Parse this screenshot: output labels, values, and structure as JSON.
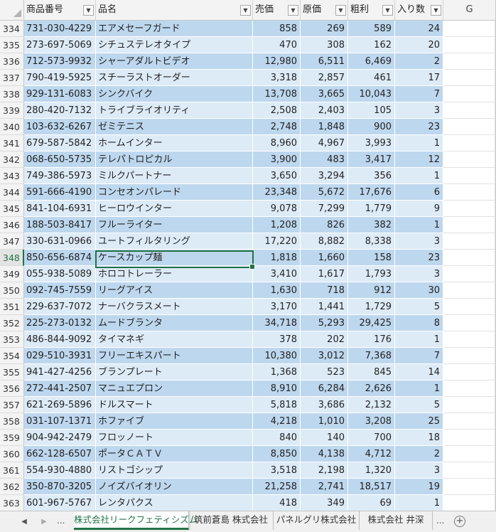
{
  "columns": {
    "a": "商品番号",
    "b": "品名",
    "c": "売価",
    "d": "原価",
    "e": "粗利",
    "f": "入り数",
    "g": "G"
  },
  "filter_icon": "filter-dropdown-icon",
  "selected_row": "348",
  "rows": [
    [
      "334",
      "731-030-4229",
      "エアメセーフガード",
      "858",
      "269",
      "589",
      "24"
    ],
    [
      "335",
      "273-697-5069",
      "シチュステレオタイプ",
      "470",
      "308",
      "162",
      "20"
    ],
    [
      "336",
      "712-573-9932",
      "シャーアダルトビデオ",
      "12,980",
      "6,511",
      "6,469",
      "2"
    ],
    [
      "337",
      "790-419-5925",
      "スチーラストオーダー",
      "3,318",
      "2,857",
      "461",
      "17"
    ],
    [
      "338",
      "929-131-6083",
      "シンクバイク",
      "13,708",
      "3,665",
      "10,043",
      "7"
    ],
    [
      "339",
      "280-420-7132",
      "トライブライオリティ",
      "2,508",
      "2,403",
      "105",
      "3"
    ],
    [
      "340",
      "103-632-6267",
      "ゼミテニス",
      "2,748",
      "1,848",
      "900",
      "23"
    ],
    [
      "341",
      "679-587-5842",
      "ホームインター",
      "8,960",
      "4,967",
      "3,993",
      "1"
    ],
    [
      "342",
      "068-650-5735",
      "テレパトロピカル",
      "3,900",
      "483",
      "3,417",
      "12"
    ],
    [
      "343",
      "749-386-5973",
      "ミルクパートナー",
      "3,650",
      "3,294",
      "356",
      "1"
    ],
    [
      "344",
      "591-666-4190",
      "コンセオンパレード",
      "23,348",
      "5,672",
      "17,676",
      "6"
    ],
    [
      "345",
      "841-104-6931",
      "ヒーロウインター",
      "9,078",
      "7,299",
      "1,779",
      "9"
    ],
    [
      "346",
      "188-503-8417",
      "フルーライター",
      "1,208",
      "826",
      "382",
      "1"
    ],
    [
      "347",
      "330-631-0966",
      "ユートフィルタリング",
      "17,220",
      "8,882",
      "8,338",
      "3"
    ],
    [
      "348",
      "850-656-6874",
      "ケースカップ麺",
      "1,818",
      "1,660",
      "158",
      "23"
    ],
    [
      "349",
      "055-938-5089",
      "ホロコトレーラー",
      "3,410",
      "1,617",
      "1,793",
      "3"
    ],
    [
      "350",
      "092-745-7559",
      "リーグアイス",
      "1,630",
      "718",
      "912",
      "30"
    ],
    [
      "351",
      "229-637-7072",
      "ナーバクラスメート",
      "3,170",
      "1,441",
      "1,729",
      "5"
    ],
    [
      "352",
      "225-273-0132",
      "ムードブランタ",
      "34,718",
      "5,293",
      "29,425",
      "8"
    ],
    [
      "353",
      "486-844-9092",
      "タイマネギ",
      "378",
      "202",
      "176",
      "1"
    ],
    [
      "354",
      "029-510-3931",
      "フリーエキスパート",
      "10,380",
      "3,012",
      "7,368",
      "7"
    ],
    [
      "355",
      "941-427-4256",
      "ブランプレート",
      "1,368",
      "523",
      "845",
      "14"
    ],
    [
      "356",
      "272-441-2507",
      "マニュエプロン",
      "8,910",
      "6,284",
      "2,626",
      "1"
    ],
    [
      "357",
      "621-269-5896",
      "ドルスマート",
      "5,818",
      "3,686",
      "2,132",
      "5"
    ],
    [
      "358",
      "031-107-1371",
      "ホファイブ",
      "4,218",
      "1,010",
      "3,208",
      "25"
    ],
    [
      "359",
      "904-942-2479",
      "フロッノート",
      "840",
      "140",
      "700",
      "18"
    ],
    [
      "360",
      "662-128-6507",
      "ポータＣＡＴＶ",
      "8,850",
      "4,138",
      "4,712",
      "2"
    ],
    [
      "361",
      "554-930-4880",
      "リストゴシップ",
      "3,518",
      "2,198",
      "1,320",
      "3"
    ],
    [
      "362",
      "350-870-3205",
      "ノイズバイオリン",
      "21,258",
      "2,741",
      "18,517",
      "19"
    ],
    [
      "363",
      "601-967-5767",
      "レンタパクス",
      "418",
      "349",
      "69",
      "1"
    ]
  ],
  "tabs": {
    "nav_prev": "◀",
    "nav_next": "▶",
    "ellipsis_left": "...",
    "items": [
      "株式会社リークフェティシズム",
      "筑前蒼島 株式会社",
      "パネルグリ株式会社",
      "株式会社 井深"
    ],
    "ellipsis_right": "...",
    "add": "+"
  },
  "colors": {
    "band_light": "#ddebf7",
    "band_dark": "#bdd7ee",
    "accent": "#217346"
  }
}
